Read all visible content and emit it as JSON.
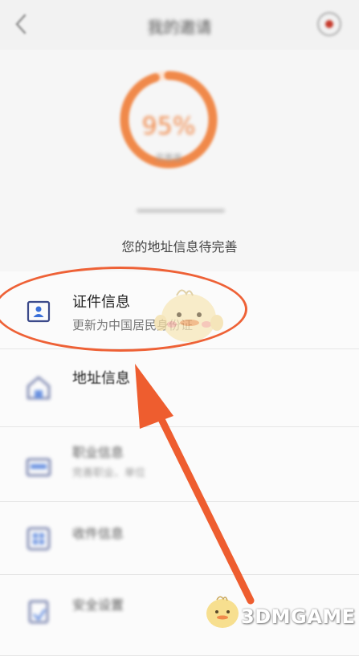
{
  "header": {
    "title": "我的邀请"
  },
  "progress": {
    "value_label": "95%",
    "caption": "完善度",
    "fraction": 0.95
  },
  "status": {
    "address_message": "您的地址信息待完善"
  },
  "list": {
    "items": [
      {
        "title": "证件信息",
        "subtitle": "更新为中国居民身份证"
      },
      {
        "title": "地址信息"
      },
      {
        "title": "职业信息",
        "subtitle": "完善职业、单位"
      },
      {
        "title": "收件信息"
      },
      {
        "title": "安全设置"
      }
    ]
  },
  "watermark": {
    "text": "3DMGAME"
  },
  "colors": {
    "accent": "#f0894a",
    "annotation": "#ee6136"
  }
}
